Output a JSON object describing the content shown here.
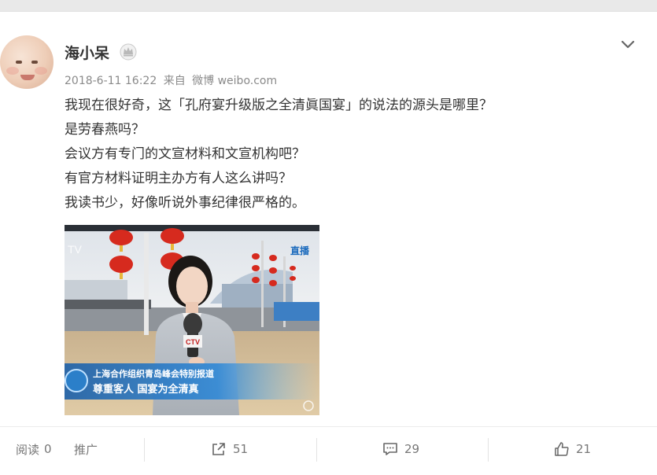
{
  "post": {
    "author": "海小呆",
    "date": "2018-6-11 16:22",
    "source_prefix": "来自",
    "source": "微博 weibo.com",
    "lines": [
      "我现在很好奇，这「孔府宴升级版之全清眞国宴」的说法的源头是哪里？",
      "是劳春燕吗？",
      "会议方有专门的文宣材料和文宣机构吧？",
      "有官方材料证明主办方有人这么讲吗？",
      "我读书少，好像听说外事纪律很严格的。"
    ]
  },
  "video": {
    "top_strip_text": "上海合作组织青岛峰会特别报道",
    "live_badge": "直播",
    "caption_line1": "上海合作组织青岛峰会特别报道",
    "caption_line2": "尊重客人 国宴为全清真"
  },
  "footer": {
    "read_label": "阅读",
    "read_count": "0",
    "promote_label": "推广",
    "share_count": "51",
    "comment_count": "29",
    "like_count": "21"
  },
  "icons": {
    "crown": "crown-icon",
    "chevron": "chevron-down-icon",
    "share": "share-icon",
    "comment": "comment-icon",
    "like": "thumbs-up-icon"
  },
  "colors": {
    "name": "#333333",
    "meta": "#8a8a8a",
    "footer_text": "#777777"
  }
}
